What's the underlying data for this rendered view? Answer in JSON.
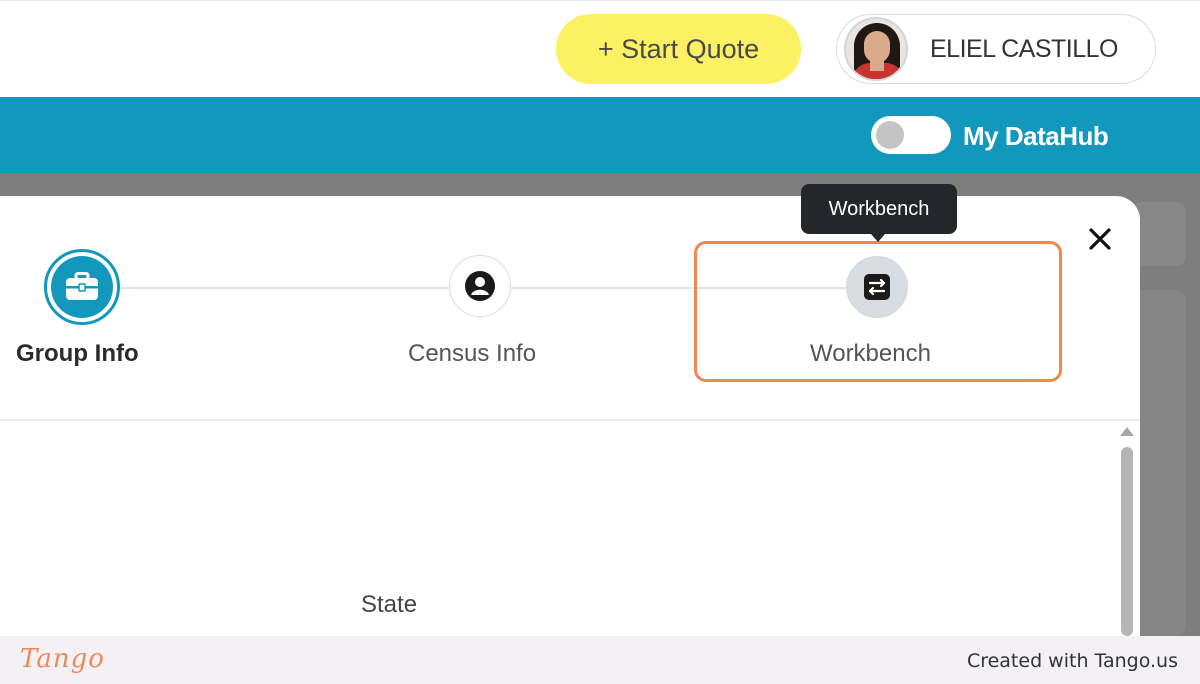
{
  "header": {
    "start_quote_label": "+ Start Quote",
    "user_name": "ELIEL CASTILLO"
  },
  "nav": {
    "toggle_label": "My DataHub",
    "toggle_on": false
  },
  "modal": {
    "steps": [
      {
        "label": "Group Info",
        "icon": "briefcase-icon",
        "state": "active"
      },
      {
        "label": "Census Info",
        "icon": "user-icon",
        "state": "inactive"
      },
      {
        "label": "Workbench",
        "icon": "workbench-icon",
        "state": "hovered"
      }
    ],
    "tooltip": "Workbench",
    "field_label": "State"
  },
  "footer": {
    "logo": "Tango",
    "credit": "Created with Tango.us"
  },
  "colors": {
    "accent": "#1297bd",
    "start_quote_bg": "#fbf162",
    "highlight": "#f0874e"
  }
}
